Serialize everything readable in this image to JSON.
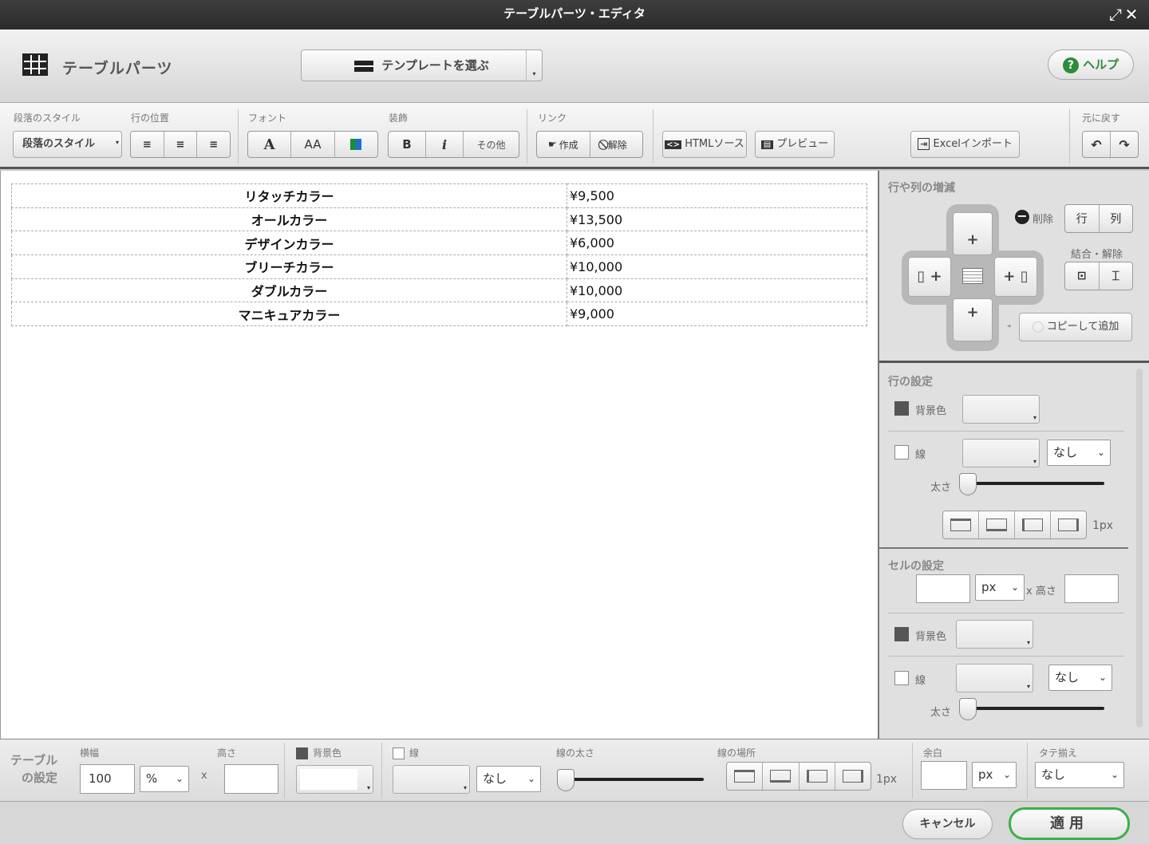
{
  "window": {
    "title": "テーブルパーツ・エディタ"
  },
  "header": {
    "title": "テーブルパーツ",
    "template_button": "テンプレートを選ぶ",
    "help_button": "ヘルプ"
  },
  "toolbar": {
    "paragraph_style_label": "段落のスタイル",
    "paragraph_style_button": "段落のスタイル",
    "line_position_label": "行の位置",
    "font_label": "フォント",
    "decoration_label": "装飾",
    "bold": "B",
    "italic": "i",
    "font_size": "AA",
    "font_face": "A",
    "other": "その他",
    "link_label": "リンク",
    "link_create": "作成",
    "link_remove": "解除",
    "html_source": "HTMLソース",
    "preview": "プレビュー",
    "excel_import": "Excelインポート",
    "undo_label": "元に戻す"
  },
  "table": {
    "rows": [
      {
        "name": "リタッチカラー",
        "price": "¥9,500"
      },
      {
        "name": "オールカラー",
        "price": "¥13,500"
      },
      {
        "name": "デザインカラー",
        "price": "¥6,000"
      },
      {
        "name": "ブリーチカラー",
        "price": "¥10,000"
      },
      {
        "name": "ダブルカラー",
        "price": "¥10,000"
      },
      {
        "name": "マニキュアカラー",
        "price": "¥9,000"
      }
    ]
  },
  "rowcol": {
    "title": "行や列の増減",
    "delete_label": "削除",
    "row": "行",
    "col": "列",
    "merge_label": "結合・解除",
    "copy_add": "コピーして追加"
  },
  "row_settings": {
    "title": "行の設定",
    "bg_label": "背景色",
    "line_label": "線",
    "line_style": "なし",
    "thickness_label": "太さ",
    "thickness_value": "1px"
  },
  "cell_settings": {
    "title": "セルの設定",
    "width_value": "",
    "unit": "px",
    "height_label": "x 高さ",
    "height_value": "",
    "bg_label": "背景色",
    "line_label": "線",
    "line_style": "なし",
    "thickness_label": "太さ"
  },
  "table_settings": {
    "title_line1": "テーブル",
    "title_line2": "の設定",
    "width_label": "横幅",
    "width_value": "100",
    "width_unit": "%",
    "x": "x",
    "height_label": "高さ",
    "height_value": "",
    "bg_label": "背景色",
    "line_label": "線",
    "line_style": "なし",
    "line_thickness_label": "線の太さ",
    "line_place_label": "線の場所",
    "thickness_value": "1px",
    "margin_label": "余白",
    "margin_unit": "px",
    "valign_label": "タテ揃え",
    "valign_value": "なし"
  },
  "footer": {
    "cancel": "キャンセル",
    "apply": "適用"
  },
  "colors": {
    "titlebar": "#2b2b2b",
    "apply_border": "#3bb04a",
    "help_icon": "#2e8b3a"
  }
}
